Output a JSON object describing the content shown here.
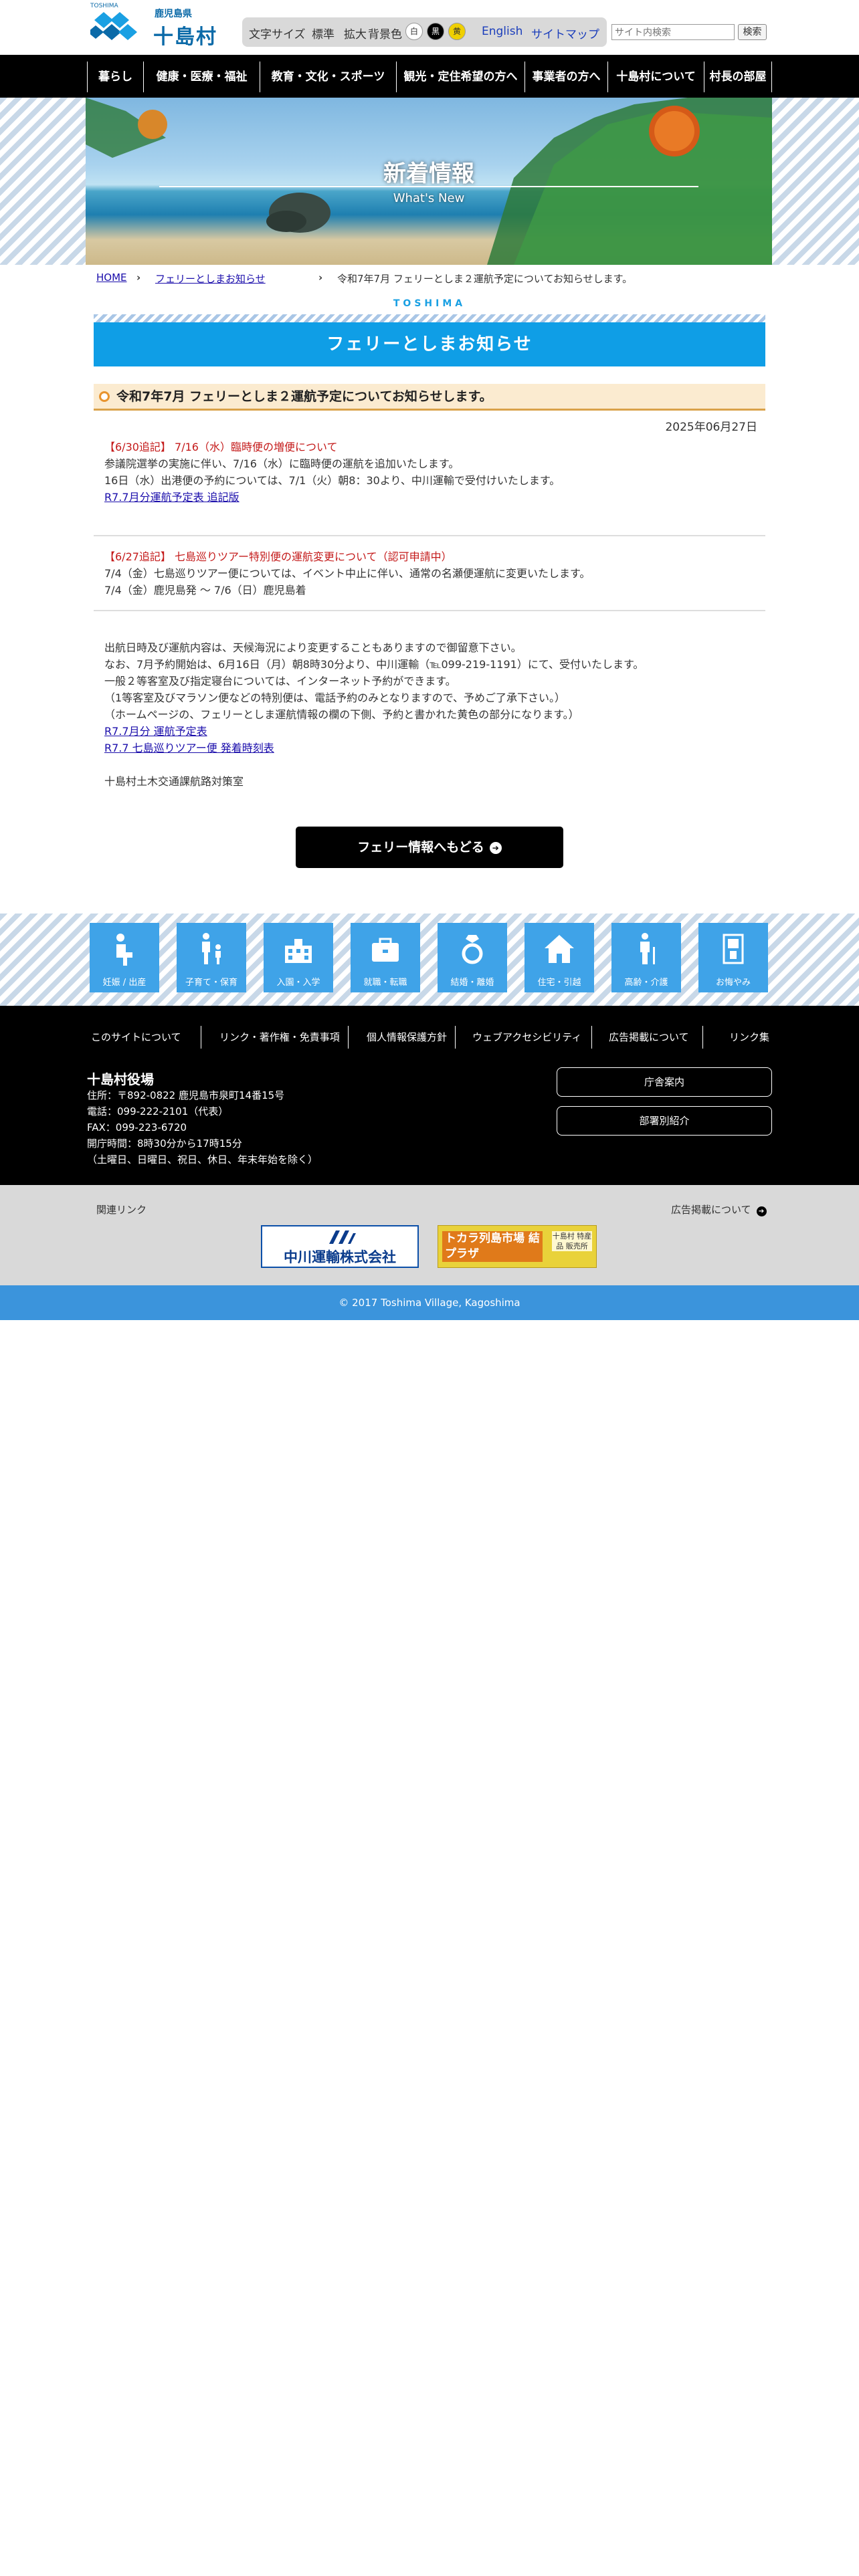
{
  "header": {
    "logo_tiny": "TOSHIMA",
    "logo_small": "鹿児島県",
    "logo_big": "十島村",
    "font_size_label": "文字サイズ",
    "font_size_standard": "標準",
    "font_size_large": "拡大",
    "bg_color_label": "背景色",
    "bg_white": "白",
    "bg_black": "黒",
    "bg_yellow": "黄",
    "english_link": "English",
    "sitemap_link": "サイトマップ",
    "search_placeholder": "サイト内検索",
    "search_button": "検索"
  },
  "nav": {
    "items": [
      "暮らし",
      "健康・医療・福祉",
      "教育・文化・スポーツ",
      "観光・定住希望の方へ",
      "事業者の方へ",
      "十島村について",
      "村長の部屋"
    ]
  },
  "hero": {
    "title": "新着情報",
    "subtitle": "What's New"
  },
  "breadcrumb": {
    "home": "HOME",
    "parent": "フェリーとしまお知らせ",
    "current": "令和7年7月 フェリーとしま２運航予定についてお知らせします。"
  },
  "section": {
    "logo": "TOSHIMA",
    "title": "フェリーとしまお知らせ"
  },
  "article": {
    "title": "令和7年7月 フェリーとしま２運航予定についてお知らせします。",
    "date": "2025年06月27日",
    "block1": {
      "heading": "【6/30追記】 7/16（水）臨時便の増便について",
      "line1": "参議院選挙の実施に伴い、7/16（水）に臨時便の運航を追加いたします。",
      "line2": "16日（水）出港便の予約については、7/1（火）朝8：30より、中川運輸で受付けいたします。",
      "link": "R7.7月分運航予定表 追記版"
    },
    "block2": {
      "heading": "【6/27追記】 七島巡りツアー特別便の運航変更について（認可申請中）",
      "line1": "7/4（金）七島巡りツアー便については、イベント中止に伴い、通常の名瀬便運航に変更いたします。",
      "line2": "7/4（金）鹿児島発 〜 7/6（日）鹿児島着"
    },
    "block3": {
      "line1": "出航日時及び運航内容は、天候海況により変更することもありますので御留意下さい。",
      "line2": "なお、7月予約開始は、6月16日（月）朝8時30分より、中川運輸（℡099-219-1191）にて、受付いたします。",
      "line3": "一般２等客室及び指定寝台については、インターネット予約ができます。",
      "line4": "（1等客室及びマラソン便などの特別便は、電話予約のみとなりますので、予めご了承下さい。）",
      "line5": "（ホームページの、フェリーとしま運航情報の欄の下側、予約と書かれた黄色の部分になります。）",
      "link1": "R7.7月分 運航予定表",
      "link2": "R7.7 七島巡りツアー便 発着時刻表",
      "signature": "十島村土木交通課航路対策室"
    },
    "return_button": "フェリー情報へもどる"
  },
  "categories": [
    {
      "label": "妊娠 / 出産",
      "icon": "pregnancy-icon"
    },
    {
      "label": "子育て・保育",
      "icon": "childcare-icon"
    },
    {
      "label": "入園・入学",
      "icon": "school-icon"
    },
    {
      "label": "就職・転職",
      "icon": "briefcase-icon"
    },
    {
      "label": "結婚・離婚",
      "icon": "ring-icon"
    },
    {
      "label": "住宅・引越",
      "icon": "house-icon"
    },
    {
      "label": "高齢・介護",
      "icon": "elderly-icon"
    },
    {
      "label": "お悔やみ",
      "icon": "condolence-icon"
    }
  ],
  "footer": {
    "links": [
      "このサイトについて",
      "リンク・著作権・免責事項",
      "個人情報保護方針",
      "ウェブアクセシビリティ",
      "広告掲載について",
      "リンク集"
    ],
    "office_name": "十島村役場",
    "address": "住所：〒892-0822 鹿児島市泉町14番15号",
    "phone": "電話：099-222-2101（代表）",
    "fax": "FAX：099-223-6720",
    "hours": "開庁時間：8時30分から17時15分",
    "closed": "（土曜日、日曜日、祝日、休日、年末年始を除く）",
    "btn_office_guide": "庁舎案内",
    "btn_departments": "部署別紹介"
  },
  "related": {
    "label": "関連リンク",
    "ad_link": "広告掲載について",
    "banner1": "中川運輸株式会社",
    "banner2_main": "トカラ列島市場 結プラザ",
    "banner2_side": "十島村 特産品 販売所"
  },
  "copyright": "© 2017 Toshima Village, Kagoshima",
  "colors": {
    "brand_blue": "#0f9ee6",
    "nav_black": "#000000",
    "accent_red": "#c41a1a",
    "footer_blue": "#3b94dc",
    "category_blue": "#3fa3e8"
  }
}
